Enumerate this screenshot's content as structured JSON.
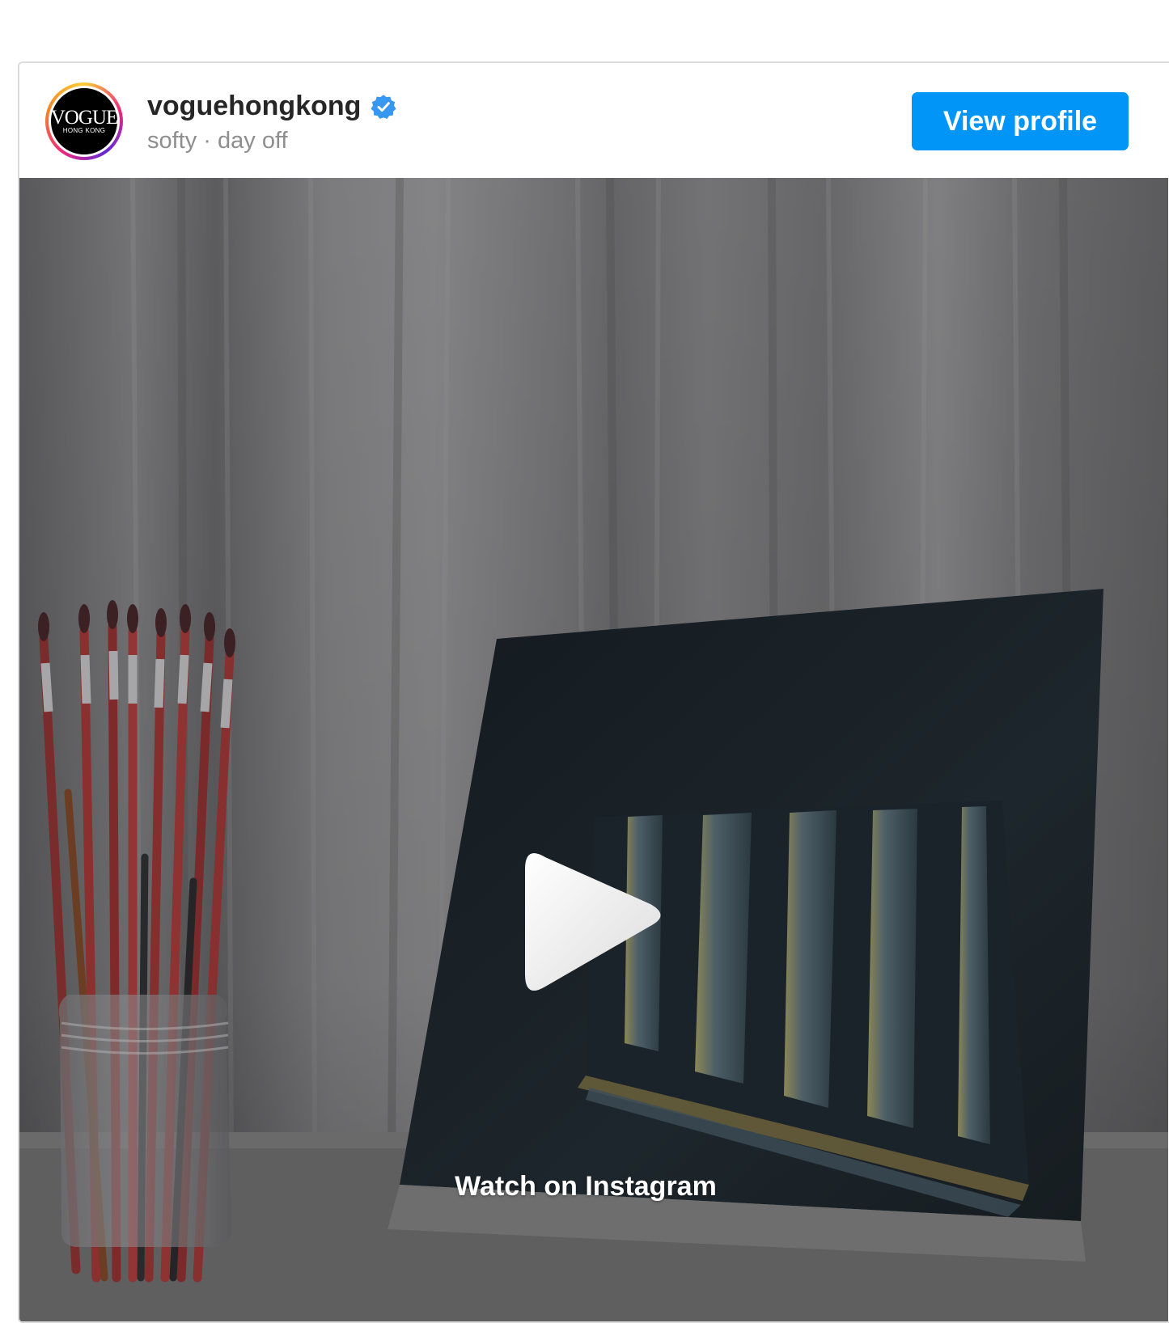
{
  "profile": {
    "username": "voguehongkong",
    "subtitle": "softy · day off",
    "avatar_word": "VOGUE",
    "avatar_sub": "HONG KONG",
    "verified_icon": "verified-badge-icon"
  },
  "actions": {
    "view_profile_label": "View profile"
  },
  "media": {
    "watch_label": "Watch on Instagram",
    "play_icon": "play-icon"
  },
  "colors": {
    "accent": "#0095f6",
    "verified": "#3897f0",
    "muted_text": "#8e8e8e"
  }
}
